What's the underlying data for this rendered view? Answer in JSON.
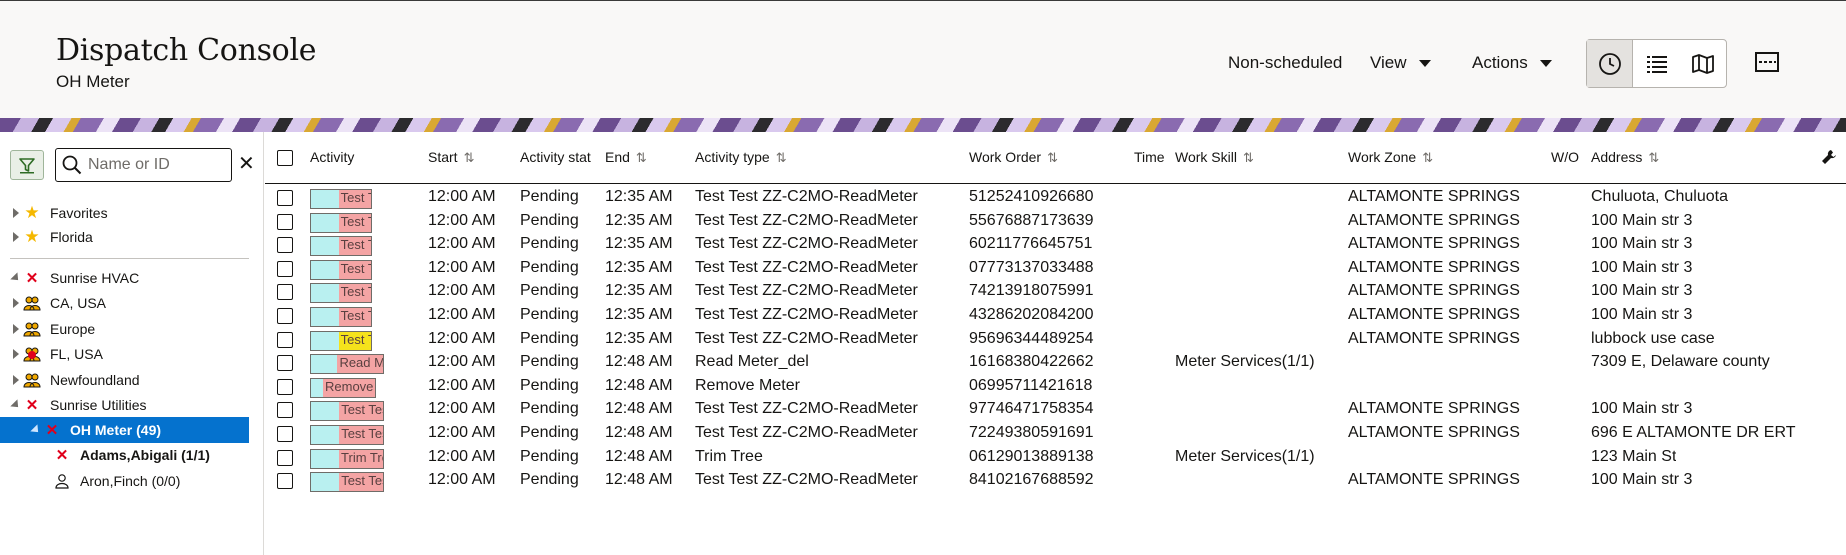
{
  "header": {
    "title": "Dispatch Console",
    "subtitle": "OH Meter",
    "nav": {
      "nonscheduled": "Non-scheduled",
      "view": "View",
      "actions": "Actions"
    },
    "view_buttons": [
      "clock-icon",
      "list-icon",
      "map-icon"
    ],
    "menu_icon": "hamburger-icon"
  },
  "sidebar": {
    "search_placeholder": "Name or ID",
    "items": [
      {
        "label": "Favorites",
        "icon": "star-icon",
        "toggle": "collapsed"
      },
      {
        "label": "Florida",
        "icon": "star-icon",
        "toggle": "collapsed"
      },
      {
        "label": "Sunrise HVAC",
        "icon": "x-icon",
        "toggle": "expanded"
      },
      {
        "label": "CA, USA",
        "icon": "group-icon",
        "toggle": "collapsed"
      },
      {
        "label": "Europe",
        "icon": "group-icon",
        "toggle": "collapsed"
      },
      {
        "label": "FL, USA",
        "icon": "group-alert-icon",
        "toggle": "collapsed"
      },
      {
        "label": "Newfoundland",
        "icon": "group-icon",
        "toggle": "collapsed"
      },
      {
        "label": "Sunrise Utilities",
        "icon": "x-icon",
        "toggle": "expanded"
      },
      {
        "label": "OH Meter (49)",
        "icon": "x-icon",
        "toggle": "expanded"
      },
      {
        "label": "Adams,Abigali (1/1)",
        "icon": "x-icon",
        "toggle": "none"
      },
      {
        "label": "Aron,Finch (0/0)",
        "icon": "person-icon",
        "toggle": "none"
      }
    ]
  },
  "grid": {
    "columns": {
      "activity": "Activity",
      "start": "Start",
      "status": "Activity stat",
      "end": "End",
      "type": "Activity type",
      "work_order": "Work Order",
      "time": "Time",
      "work_skill": "Work Skill",
      "work_zone": "Work Zone",
      "wo": "W/O",
      "address": "Address"
    },
    "rows": [
      {
        "chip": "Test T",
        "chip_color": "#f4a4a4",
        "start": "12:00 AM",
        "status": "Pending",
        "end": "12:35 AM",
        "type": "Test Test ZZ-C2MO-ReadMeter",
        "work_order": "51252410926680",
        "skill": "",
        "zone": "ALTAMONTE SPRINGS",
        "address": "Chuluota, Chuluota"
      },
      {
        "chip": "Test T",
        "chip_color": "#f4a4a4",
        "start": "12:00 AM",
        "status": "Pending",
        "end": "12:35 AM",
        "type": "Test Test ZZ-C2MO-ReadMeter",
        "work_order": "55676887173639",
        "skill": "",
        "zone": "ALTAMONTE SPRINGS",
        "address": "100 Main str 3"
      },
      {
        "chip": "Test T",
        "chip_color": "#f4a4a4",
        "start": "12:00 AM",
        "status": "Pending",
        "end": "12:35 AM",
        "type": "Test Test ZZ-C2MO-ReadMeter",
        "work_order": "60211776645751",
        "skill": "",
        "zone": "ALTAMONTE SPRINGS",
        "address": "100 Main str 3"
      },
      {
        "chip": "Test T",
        "chip_color": "#f4a4a4",
        "start": "12:00 AM",
        "status": "Pending",
        "end": "12:35 AM",
        "type": "Test Test ZZ-C2MO-ReadMeter",
        "work_order": "07773137033488",
        "skill": "",
        "zone": "ALTAMONTE SPRINGS",
        "address": "100 Main str 3"
      },
      {
        "chip": "Test T",
        "chip_color": "#f4a4a4",
        "start": "12:00 AM",
        "status": "Pending",
        "end": "12:35 AM",
        "type": "Test Test ZZ-C2MO-ReadMeter",
        "work_order": "74213918075991",
        "skill": "",
        "zone": "ALTAMONTE SPRINGS",
        "address": "100 Main str 3"
      },
      {
        "chip": "Test T",
        "chip_color": "#f4a4a4",
        "start": "12:00 AM",
        "status": "Pending",
        "end": "12:35 AM",
        "type": "Test Test ZZ-C2MO-ReadMeter",
        "work_order": "43286202084200",
        "skill": "",
        "zone": "ALTAMONTE SPRINGS",
        "address": "100 Main str 3"
      },
      {
        "chip": "Test T",
        "chip_color": "#f5e21c",
        "start": "12:00 AM",
        "status": "Pending",
        "end": "12:35 AM",
        "type": "Test Test ZZ-C2MO-ReadMeter",
        "work_order": "95696344489254",
        "skill": "",
        "zone": "ALTAMONTE SPRINGS",
        "address": "lubbock use case"
      },
      {
        "chip": "Read Me",
        "chip_color": "#f4a4a4",
        "start": "12:00 AM",
        "status": "Pending",
        "end": "12:48 AM",
        "type": "Read Meter_del",
        "work_order": "16168380422662",
        "skill": "Meter Services(1/1)",
        "zone": "",
        "address": "7309 E, Delaware county"
      },
      {
        "chip": "Remove",
        "chip_color": "#f4a4a4",
        "start": "12:00 AM",
        "status": "Pending",
        "end": "12:48 AM",
        "type": "Remove Meter",
        "work_order": "06995711421618",
        "skill": "",
        "zone": "",
        "address": ""
      },
      {
        "chip": "Test Tes",
        "chip_color": "#f4a4a4",
        "start": "12:00 AM",
        "status": "Pending",
        "end": "12:48 AM",
        "type": "Test Test ZZ-C2MO-ReadMeter",
        "work_order": "97746471758354",
        "skill": "",
        "zone": "ALTAMONTE SPRINGS",
        "address": "100 Main str 3"
      },
      {
        "chip": "Test Tes",
        "chip_color": "#f4a4a4",
        "start": "12:00 AM",
        "status": "Pending",
        "end": "12:48 AM",
        "type": "Test Test ZZ-C2MO-ReadMeter",
        "work_order": "72249380591691",
        "skill": "",
        "zone": "ALTAMONTE SPRINGS",
        "address": "696 E ALTAMONTE DR ERT"
      },
      {
        "chip": "Trim Tre",
        "chip_color": "#f4a4a4",
        "start": "12:00 AM",
        "status": "Pending",
        "end": "12:48 AM",
        "type": "Trim Tree",
        "work_order": "06129013889138",
        "skill": "Meter Services(1/1)",
        "zone": "",
        "address": "123 Main St"
      },
      {
        "chip": "Test Tes",
        "chip_color": "#f4a4a4",
        "start": "12:00 AM",
        "status": "Pending",
        "end": "12:48 AM",
        "type": "Test Test ZZ-C2MO-ReadMeter",
        "work_order": "84102167688592",
        "skill": "",
        "zone": "ALTAMONTE SPRINGS",
        "address": "100 Main str 3"
      }
    ]
  },
  "colors": {
    "accent": "#0572ce",
    "alert": "#e0001b",
    "star": "#f5b800",
    "group": "#f0a800"
  }
}
